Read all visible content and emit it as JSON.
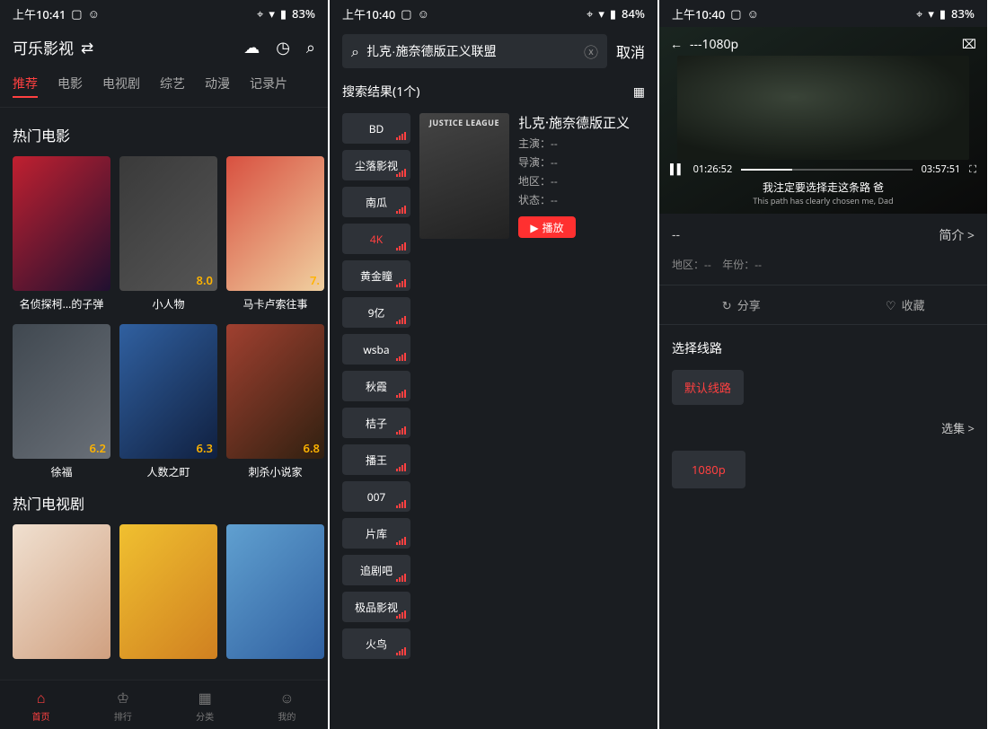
{
  "screen1": {
    "status": {
      "time": "上午10:41",
      "battery": "83%"
    },
    "title": "可乐影视",
    "header_icons": [
      "notify-icon",
      "history-icon",
      "search-icon"
    ],
    "tabs": [
      "推荐",
      "电影",
      "电视剧",
      "综艺",
      "动漫",
      "记录片"
    ],
    "active_tab_index": 0,
    "sections": [
      {
        "title": "热门电影",
        "items": [
          {
            "name": "名侦探柯...的子弹",
            "rating": ""
          },
          {
            "name": "小人物",
            "rating": "8.0"
          },
          {
            "name": "马卡卢索往事",
            "rating": "7."
          }
        ]
      },
      {
        "title": "",
        "items": [
          {
            "name": "徐福",
            "rating": "6.2"
          },
          {
            "name": "人数之町",
            "rating": "6.3"
          },
          {
            "name": "刺杀小说家",
            "rating": "6.8"
          }
        ]
      },
      {
        "title": "热门电视剧",
        "items": [
          {
            "name": "",
            "rating": ""
          },
          {
            "name": "",
            "rating": ""
          },
          {
            "name": "",
            "rating": ""
          }
        ]
      }
    ],
    "bottom_tabs": [
      {
        "label": "首页",
        "icon": "home-icon"
      },
      {
        "label": "排行",
        "icon": "crown-icon"
      },
      {
        "label": "分类",
        "icon": "grid-icon"
      },
      {
        "label": "我的",
        "icon": "user-icon"
      }
    ],
    "active_bottom_index": 0
  },
  "screen2": {
    "status": {
      "time": "上午10:40",
      "battery": "84%"
    },
    "search_value": "扎克·施奈德版正义联盟",
    "cancel_label": "取消",
    "results_label": "搜索结果(1个)",
    "sources": [
      "BD",
      "尘落影视",
      "南瓜",
      "4K",
      "黄金瞳",
      "9亿",
      "wsba",
      "秋霞",
      "桔子",
      "播王",
      "007",
      "片库",
      "追剧吧",
      "极品影视",
      "火鸟"
    ],
    "active_source_index": 3,
    "result": {
      "title": "扎克·施奈德版正义",
      "actor_label": "主演：",
      "actor_value": "--",
      "director_label": "导演：",
      "director_value": "--",
      "region_label": "地区：",
      "region_value": "--",
      "status_label": "状态：",
      "status_value": "--",
      "play_label": "播放"
    }
  },
  "screen3": {
    "status": {
      "time": "上午10:40",
      "battery": "83%"
    },
    "player": {
      "title": "---1080p",
      "current": "01:26:52",
      "duration": "03:57:51",
      "subtitle_zh": "我注定要选择走这条路 爸",
      "subtitle_en": "This path has clearly chosen me, Dad"
    },
    "info_title": "--",
    "brief_label": "简介 >",
    "meta_region_label": "地区：",
    "meta_region_value": "--",
    "meta_year_label": "年份：",
    "meta_year_value": "--",
    "action_share": "分享",
    "action_fav": "收藏",
    "route_title": "选择线路",
    "route_button": "默认线路",
    "episodes_label": "选集 >",
    "episode_button": "1080p"
  }
}
